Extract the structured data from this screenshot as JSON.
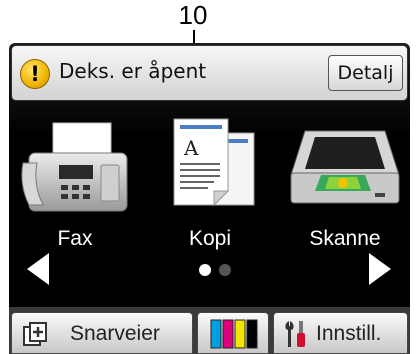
{
  "callout": {
    "number": "10"
  },
  "status": {
    "icon": "warning-icon",
    "message": "Deks. er åpent",
    "detail_button": "Detalj"
  },
  "apps": [
    {
      "label": "Fax",
      "icon": "fax-machine-icon"
    },
    {
      "label": "Kopi",
      "icon": "copy-documents-icon"
    },
    {
      "label": "Skanne",
      "icon": "scanner-icon"
    }
  ],
  "navigation": {
    "prev_icon": "left-arrow-icon",
    "next_icon": "right-arrow-icon",
    "page_count": 2,
    "current_page": 1
  },
  "bottom_bar": {
    "shortcuts": {
      "label": "Snarveier",
      "icon": "shortcuts-icon"
    },
    "ink": {
      "icon": "ink-cartridges-icon",
      "colors": [
        "#00a0e0",
        "#e0007a",
        "#f2e600",
        "#000000"
      ]
    },
    "settings": {
      "label": "Innstill.",
      "icon": "tools-icon"
    }
  },
  "colors": {
    "warning": "#f2b400",
    "screen_background": "#000000"
  }
}
